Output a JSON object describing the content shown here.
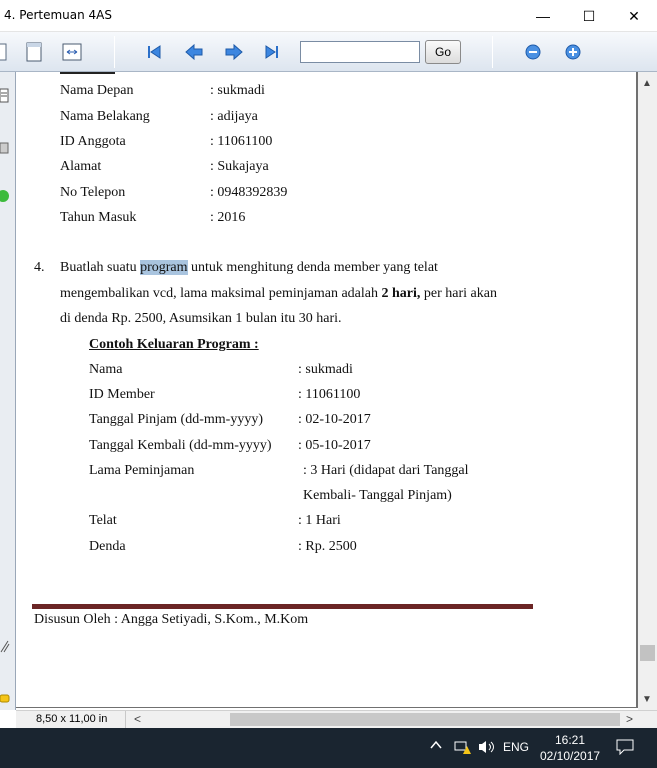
{
  "window": {
    "title": "4. Pertemuan 4AS",
    "minimize_glyph": "—",
    "maximize_glyph": "☐",
    "close_glyph": "✕"
  },
  "toolbar": {
    "page_input_value": "",
    "go_label": "Go",
    "icons": [
      "page-icon",
      "fit-width-icon",
      "first-page-icon",
      "prev-page-icon",
      "next-page-icon",
      "last-page-icon",
      "zoom-out-icon",
      "zoom-in-icon"
    ]
  },
  "profile": {
    "rows": [
      {
        "label": "Nama Depan",
        "value": ": sukmadi"
      },
      {
        "label": "Nama Belakang",
        "value": ": adijaya"
      },
      {
        "label": "ID Anggota",
        "value": ": 11061100"
      },
      {
        "label": "Alamat",
        "value": ": Sukajaya"
      },
      {
        "label": "No Telepon",
        "value": ": 0948392839"
      },
      {
        "label": "Tahun Masuk",
        "value": ": 2016"
      }
    ]
  },
  "task4": {
    "number": "4.",
    "line1_pre": "Buatlah suatu ",
    "line1_highlight": "program",
    "line1_post": " untuk menghitung denda member yang telat",
    "line2_pre": "mengembalikan vcd, lama maksimal peminjaman adalah ",
    "line2_bold": "2 hari,",
    "line2_post": " per hari akan",
    "line3": "di denda Rp. 2500, Asumsikan 1 bulan itu 30 hari.",
    "example_heading": "Contoh Keluaran Program :",
    "rows": [
      {
        "label": "Nama",
        "value": ": sukmadi"
      },
      {
        "label": "ID Member",
        "value": ": 11061100"
      },
      {
        "label": "Tanggal Pinjam (dd-mm-yyyy)",
        "value": ": 02-10-2017"
      },
      {
        "label": "Tanggal Kembali (dd-mm-yyyy)",
        "value": ": 05-10-2017"
      },
      {
        "label": "Lama Peminjaman",
        "value": ": 3 Hari (didapat dari Tanggal"
      },
      {
        "label": "",
        "value": "Kembali- Tanggal Pinjam)"
      },
      {
        "label": "Telat",
        "value": ": 1 Hari"
      },
      {
        "label": "Denda",
        "value": ": Rp. 2500"
      }
    ]
  },
  "footer": {
    "text": "Disusun Oleh : Angga Setiyadi, S.Kom., M.Kom"
  },
  "statusbar": {
    "page_size": "8,50 x 11,00 in",
    "scroll_left_glyph": "<",
    "scroll_right_glyph": ">"
  },
  "taskbar": {
    "language": "ENG",
    "time": "16:21",
    "date": "02/10/2017"
  }
}
